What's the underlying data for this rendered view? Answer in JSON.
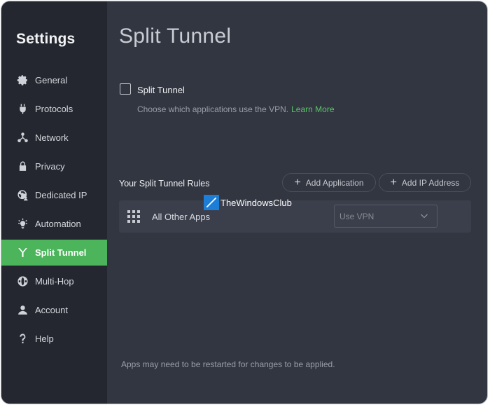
{
  "sidebar": {
    "title": "Settings",
    "items": [
      {
        "label": "General",
        "icon": "gear-icon"
      },
      {
        "label": "Protocols",
        "icon": "plug-icon"
      },
      {
        "label": "Network",
        "icon": "network-icon"
      },
      {
        "label": "Privacy",
        "icon": "lock-icon"
      },
      {
        "label": "Dedicated IP",
        "icon": "globe-person-icon"
      },
      {
        "label": "Automation",
        "icon": "bulb-icon"
      },
      {
        "label": "Split Tunnel",
        "icon": "split-icon",
        "active": true
      },
      {
        "label": "Multi-Hop",
        "icon": "globe-icon"
      },
      {
        "label": "Account",
        "icon": "user-icon"
      },
      {
        "label": "Help",
        "icon": "question-icon"
      }
    ],
    "accent_color": "#4cb55b"
  },
  "main": {
    "title": "Split Tunnel",
    "toggle_label": "Split Tunnel",
    "toggle_checked": false,
    "description": "Choose which applications use the VPN.",
    "learn_more": "Learn More",
    "rules_title": "Your Split Tunnel Rules",
    "add_application": "Add Application",
    "add_ip": "Add IP Address",
    "rules": [
      {
        "app": "All Other Apps",
        "mode": "Use VPN"
      }
    ],
    "footer": "Apps may need to be restarted for changes to be applied."
  },
  "watermark": {
    "text": "TheWindowsClub"
  }
}
